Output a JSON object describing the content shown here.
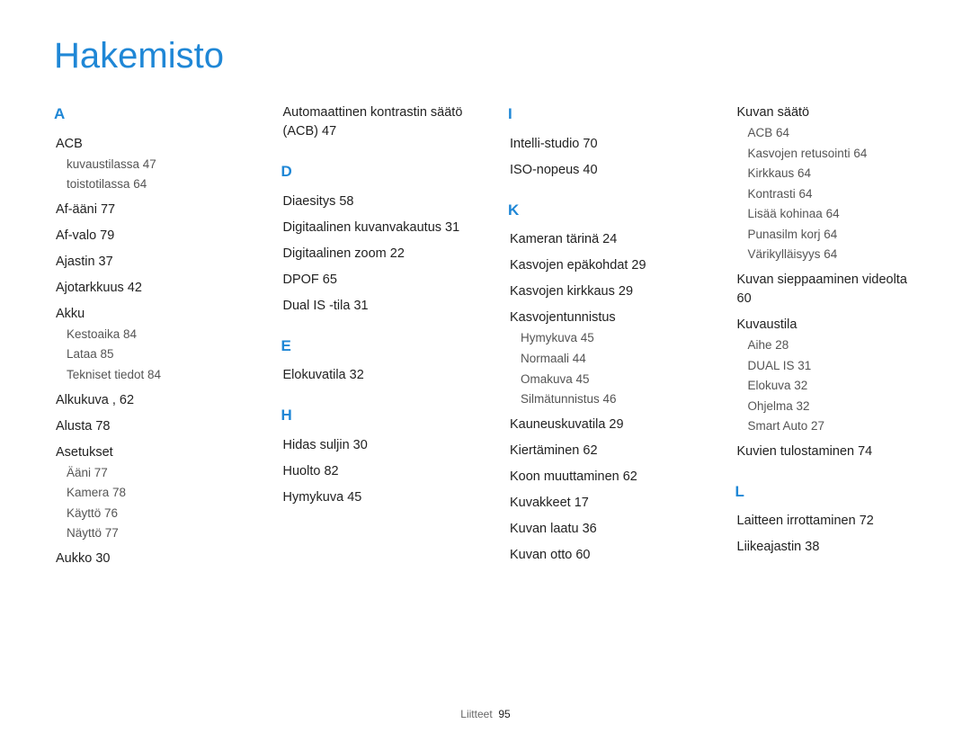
{
  "title": "Hakemisto",
  "footer": {
    "label": "Liitteet",
    "page": "95"
  },
  "cols": [
    [
      {
        "type": "letter",
        "text": "A"
      },
      {
        "type": "entry",
        "label": "ACB",
        "page": "",
        "subs": [
          {
            "label": "kuvaustilassa",
            "page": "47"
          },
          {
            "label": "toistotilassa",
            "page": "64"
          }
        ]
      },
      {
        "type": "entry",
        "label": "Af-ääni",
        "page": "77"
      },
      {
        "type": "entry",
        "label": "Af-valo",
        "page": "79"
      },
      {
        "type": "entry",
        "label": "Ajastin",
        "page": "37"
      },
      {
        "type": "entry",
        "label": "Ajotarkkuus",
        "page": "42"
      },
      {
        "type": "entry",
        "label": "Akku",
        "page": "",
        "subs": [
          {
            "label": "Kestoaika",
            "page": "84"
          },
          {
            "label": "Lataa",
            "page": "85"
          },
          {
            "label": "Tekniset tiedot",
            "page": "84"
          }
        ]
      },
      {
        "type": "entry",
        "label": "Alkukuva",
        "page": ", 62"
      },
      {
        "type": "entry",
        "label": "Alusta",
        "page": "78"
      },
      {
        "type": "entry",
        "label": "Asetukset",
        "page": "",
        "subs": [
          {
            "label": "Ääni",
            "page": "77"
          },
          {
            "label": "Kamera",
            "page": "78"
          },
          {
            "label": "Käyttö",
            "page": "76"
          },
          {
            "label": "Näyttö",
            "page": "77"
          }
        ]
      },
      {
        "type": "entry",
        "label": "Aukko",
        "page": "30"
      }
    ],
    [
      {
        "type": "entry",
        "label": "Automaattinen kontrastin säätö (ACB)",
        "page": "47",
        "first": true
      },
      {
        "type": "letter",
        "text": "D"
      },
      {
        "type": "entry",
        "label": "Diaesitys",
        "page": "58"
      },
      {
        "type": "entry",
        "label": "Digitaalinen kuvanvakautus",
        "page": "31"
      },
      {
        "type": "entry",
        "label": "Digitaalinen zoom",
        "page": "22"
      },
      {
        "type": "entry",
        "label": "DPOF",
        "page": "65"
      },
      {
        "type": "entry",
        "label": "Dual IS -tila",
        "page": "31"
      },
      {
        "type": "letter",
        "text": "E"
      },
      {
        "type": "entry",
        "label": "Elokuvatila",
        "page": "32"
      },
      {
        "type": "letter",
        "text": "H"
      },
      {
        "type": "entry",
        "label": "Hidas suljin",
        "page": "30"
      },
      {
        "type": "entry",
        "label": "Huolto",
        "page": "82"
      },
      {
        "type": "entry",
        "label": "Hymykuva",
        "page": "45"
      }
    ],
    [
      {
        "type": "letter",
        "text": "I"
      },
      {
        "type": "entry",
        "label": "Intelli-studio",
        "page": "70"
      },
      {
        "type": "entry",
        "label": "ISO-nopeus",
        "page": "40"
      },
      {
        "type": "letter",
        "text": "K"
      },
      {
        "type": "entry",
        "label": "Kameran tärinä",
        "page": "24"
      },
      {
        "type": "entry",
        "label": "Kasvojen epäkohdat",
        "page": "29"
      },
      {
        "type": "entry",
        "label": "Kasvojen kirkkaus",
        "page": "29"
      },
      {
        "type": "entry",
        "label": "Kasvojentunnistus",
        "page": "",
        "subs": [
          {
            "label": "Hymykuva",
            "page": "45"
          },
          {
            "label": "Normaali",
            "page": "44"
          },
          {
            "label": "Omakuva",
            "page": "45"
          },
          {
            "label": "Silmätunnistus",
            "page": "46"
          }
        ]
      },
      {
        "type": "entry",
        "label": "Kauneuskuvatila",
        "page": "29"
      },
      {
        "type": "entry",
        "label": "Kiertäminen",
        "page": "62"
      },
      {
        "type": "entry",
        "label": "Koon muuttaminen",
        "page": "62"
      },
      {
        "type": "entry",
        "label": "Kuvakkeet",
        "page": "17"
      },
      {
        "type": "entry",
        "label": "Kuvan laatu",
        "page": "36"
      },
      {
        "type": "entry",
        "label": "Kuvan otto",
        "page": "60"
      }
    ],
    [
      {
        "type": "entry",
        "label": "Kuvan säätö",
        "page": "",
        "first": true,
        "subs": [
          {
            "label": "ACB",
            "page": "64"
          },
          {
            "label": "Kasvojen retusointi",
            "page": "64"
          },
          {
            "label": "Kirkkaus",
            "page": "64"
          },
          {
            "label": "Kontrasti",
            "page": "64"
          },
          {
            "label": "Lisää kohinaa",
            "page": "64"
          },
          {
            "label": "Punasilm korj",
            "page": "64"
          },
          {
            "label": "Värikylläisyys",
            "page": "64"
          }
        ]
      },
      {
        "type": "entry",
        "label": "Kuvan sieppaaminen videolta",
        "page": "60"
      },
      {
        "type": "entry",
        "label": "Kuvaustila",
        "page": "",
        "subs": [
          {
            "label": "Aihe",
            "page": "28"
          },
          {
            "label": "DUAL IS",
            "page": "31"
          },
          {
            "label": "Elokuva",
            "page": "32"
          },
          {
            "label": "Ohjelma",
            "page": "32"
          },
          {
            "label": "Smart Auto",
            "page": "27"
          }
        ]
      },
      {
        "type": "entry",
        "label": "Kuvien tulostaminen",
        "page": "74"
      },
      {
        "type": "letter",
        "text": "L"
      },
      {
        "type": "entry",
        "label": "Laitteen irrottaminen",
        "page": "72"
      },
      {
        "type": "entry",
        "label": "Liikeajastin",
        "page": "38"
      }
    ]
  ]
}
